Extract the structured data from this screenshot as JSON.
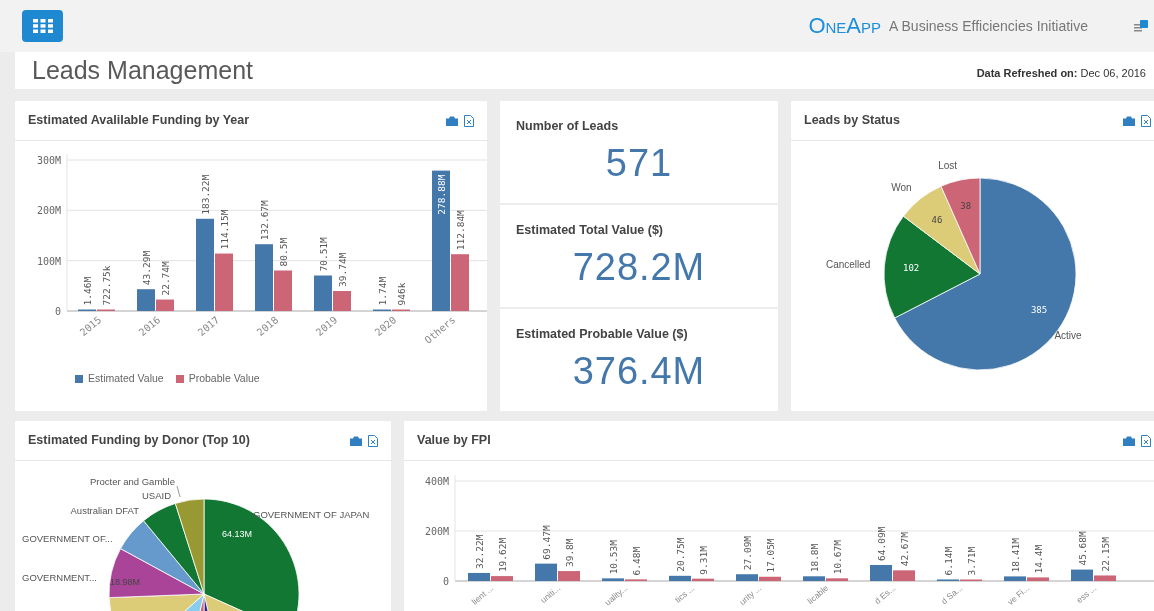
{
  "header": {
    "brand": "OneApp",
    "tagline": "A Business Efficiencies Initiative"
  },
  "page": {
    "title": "Leads Management",
    "refreshed": "**Data Refreshed on:** Dec 06, 2016"
  },
  "funding_by_year": {
    "title": "Estimated Avalilable Funding by Year",
    "chart_data": {
      "type": "bar",
      "categories": [
        "2015",
        "2016",
        "2017",
        "2018",
        "2019",
        "2020",
        "Others"
      ],
      "series": [
        {
          "name": "Estimated Value",
          "color": "#4477aa",
          "values": [
            1.46,
            43.29,
            183.22,
            132.67,
            70.51,
            1.74,
            278.88
          ]
        },
        {
          "name": "Probable Value",
          "color": "#cc6677",
          "values": [
            0.72275,
            22.74,
            114.15,
            80.5,
            39.74,
            0.945,
            112.84
          ]
        }
      ],
      "value_labels": [
        [
          "1.46M",
          "43.29M",
          "183.22M",
          "132.67M",
          "70.51M",
          "1.74M",
          "278.88M"
        ],
        [
          "722.75k",
          "22.74M",
          "114.15M",
          "80.5M",
          "39.74M",
          "946k",
          "112.84M"
        ]
      ],
      "ylim": [
        0,
        300
      ],
      "yticks": [
        {
          "value": 0,
          "label": "0"
        },
        {
          "value": 100,
          "label": "100M"
        },
        {
          "value": 200,
          "label": "200M"
        },
        {
          "value": 300,
          "label": "300M"
        }
      ]
    }
  },
  "kpis": [
    {
      "label": "Number of Leads",
      "value": "571"
    },
    {
      "label": "Estimated Total Value ($)",
      "value": "728.2M"
    },
    {
      "label": "Estimated Probable Value ($)",
      "value": "376.4M"
    }
  ],
  "leads_by_status": {
    "title": "Leads by Status",
    "chart_data": {
      "type": "pie",
      "categories": [
        "Active",
        "Cancelled",
        "Won",
        "Lost"
      ],
      "values": [
        385,
        102,
        46,
        38
      ],
      "colors": [
        "#4477aa",
        "#117733",
        "#ddcc77",
        "#cc6677"
      ],
      "data_labels": true
    }
  },
  "funding_by_donor": {
    "title": "Estimated Funding by Donor (Top 10)",
    "labels": [
      {
        "text": "Procter and Gamble"
      },
      {
        "text": "USAID"
      },
      {
        "text": "Australian DFAT"
      },
      {
        "text": "GOVERNMENT OF..."
      },
      {
        "text": "GOVERNMENT..."
      },
      {
        "text": "GOVERNMENT OF JAPAN"
      }
    ],
    "slice_labels": [
      "64.13M",
      "18.98M"
    ]
  },
  "value_by_fpi": {
    "title": "Value by FPI",
    "chart_data": {
      "type": "bar",
      "categories": [
        "lient ...",
        "uniti...",
        "uality...",
        "tics ...",
        "urity ...",
        "licable",
        "d Es...",
        "d Sa...",
        "ve Fi...",
        "ess ..."
      ],
      "series": [
        {
          "color": "#4477aa",
          "values": [
            32.22,
            69.47,
            10.53,
            20.75,
            27.09,
            18.8,
            64.09,
            6.14,
            18.41,
            45.68
          ]
        },
        {
          "color": "#cc6677",
          "values": [
            19.62,
            39.8,
            6.48,
            9.31,
            17.05,
            10.67,
            42.67,
            3.71,
            14.4,
            22.15
          ]
        }
      ],
      "value_labels": [
        [
          "32.22M",
          "69.47M",
          "10.53M",
          "20.75M",
          "27.09M",
          "18.8M",
          "64.09M",
          "6.14M",
          "18.41M",
          "45.68M"
        ],
        [
          "19.62M",
          "39.8M",
          "6.48M",
          "9.31M",
          "17.05M",
          "10.67M",
          "42.67M",
          "3.71M",
          "14.4M",
          "22.15M"
        ]
      ],
      "ylim": [
        0,
        400
      ],
      "yticks": [
        {
          "value": 0,
          "label": "0"
        },
        {
          "value": 200,
          "label": "200M"
        },
        {
          "value": 400,
          "label": "400M"
        }
      ]
    }
  }
}
